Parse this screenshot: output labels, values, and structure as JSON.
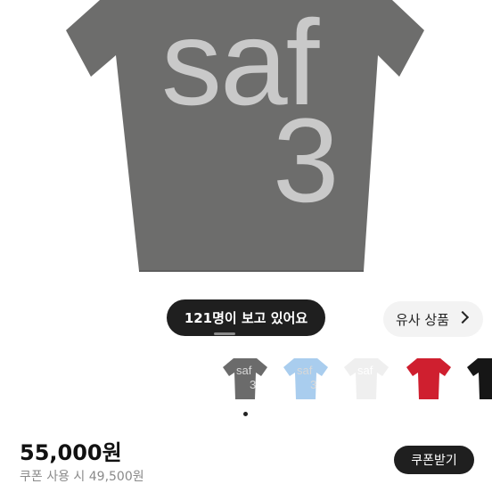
{
  "product_image": {
    "print_line1": "saf",
    "print_line2": "3",
    "shirt_color": "#6d6d6c",
    "print_color": "#c9c9c9"
  },
  "viewers_text": "121명이 보고 있어요",
  "similar_products": {
    "label": "유사 상품",
    "icon": "chevron-right-icon"
  },
  "thumbnails": [
    {
      "color": "#6b6b6b",
      "print": "saf",
      "print2": "3"
    },
    {
      "color": "#a9cdee",
      "print": "saf",
      "print2": "3"
    },
    {
      "color": "#efefef",
      "print": "saf",
      "print2": ""
    },
    {
      "color": "#cf1f2f",
      "print": "",
      "print2": ""
    },
    {
      "color": "#161616",
      "print": "",
      "print2": ""
    }
  ],
  "price": "55,000원",
  "coupon_price_text": "쿠폰 사용 시 49,500원",
  "coupon_button_label": "쿠폰받기"
}
